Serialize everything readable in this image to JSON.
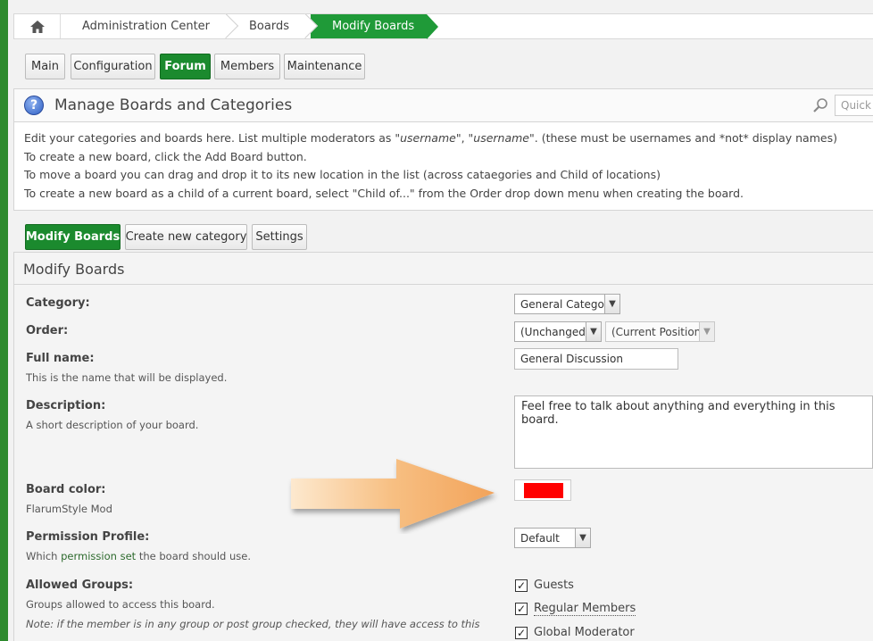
{
  "breadcrumb": {
    "home_icon": "home-icon",
    "items": [
      "Administration Center",
      "Boards",
      "Modify Boards"
    ]
  },
  "top_tabs": [
    "Main",
    "Configuration",
    "Forum",
    "Members",
    "Maintenance"
  ],
  "top_tabs_active": "Forum",
  "manage": {
    "title": "Manage Boards and Categories",
    "search_placeholder": "Quick S",
    "line1_a": "Edit your categories and boards here. List multiple moderators as ",
    "line1_u1": "\"username\"",
    "line1_sep": ", ",
    "line1_u2": "\"username\"",
    "line1_b": ". (these must be usernames and *not* display names)",
    "line2": "To create a new board, click the Add Board button.",
    "line3": "To move a board you can drag and drop it to its new location in the list (across cataegories and Child of locations)",
    "line4": "To create a new board as a child of a current board, select \"Child of...\" from the Order drop down menu when creating the board."
  },
  "sub_tabs": [
    "Modify Boards",
    "Create new category",
    "Settings"
  ],
  "modify": {
    "title": "Modify Boards",
    "category_label": "Category:",
    "category_value": "General Category",
    "order_label": "Order:",
    "order_value": "(Unchanged)",
    "position_value": "(Current Position)",
    "fullname_label": "Full name:",
    "fullname_sub": "This is the name that will be displayed.",
    "fullname_value": "General Discussion",
    "description_label": "Description:",
    "description_sub": "A short description of your board.",
    "description_value": "Feel free to talk about anything and everything in this board.",
    "color_label": "Board color:",
    "color_sub": "FlarumStyle Mod",
    "color_value": "#ff0000",
    "permission_label": "Permission Profile:",
    "permission_sub_a": "Which ",
    "permission_sub_link": "permission set",
    "permission_sub_b": " the board should use.",
    "permission_value": "Default",
    "groups_label": "Allowed Groups:",
    "groups_sub": "Groups allowed to access this board.",
    "groups_note": "Note: if the member is in any group or post group checked, they will have access to this",
    "groups": [
      {
        "name": "Guests",
        "checked": true
      },
      {
        "name": "Regular Members",
        "checked": true
      },
      {
        "name": "Global Moderator",
        "checked": true
      }
    ]
  },
  "colors": {
    "accent_green": "#1b8a2e",
    "arrow": "#f5b06a"
  }
}
